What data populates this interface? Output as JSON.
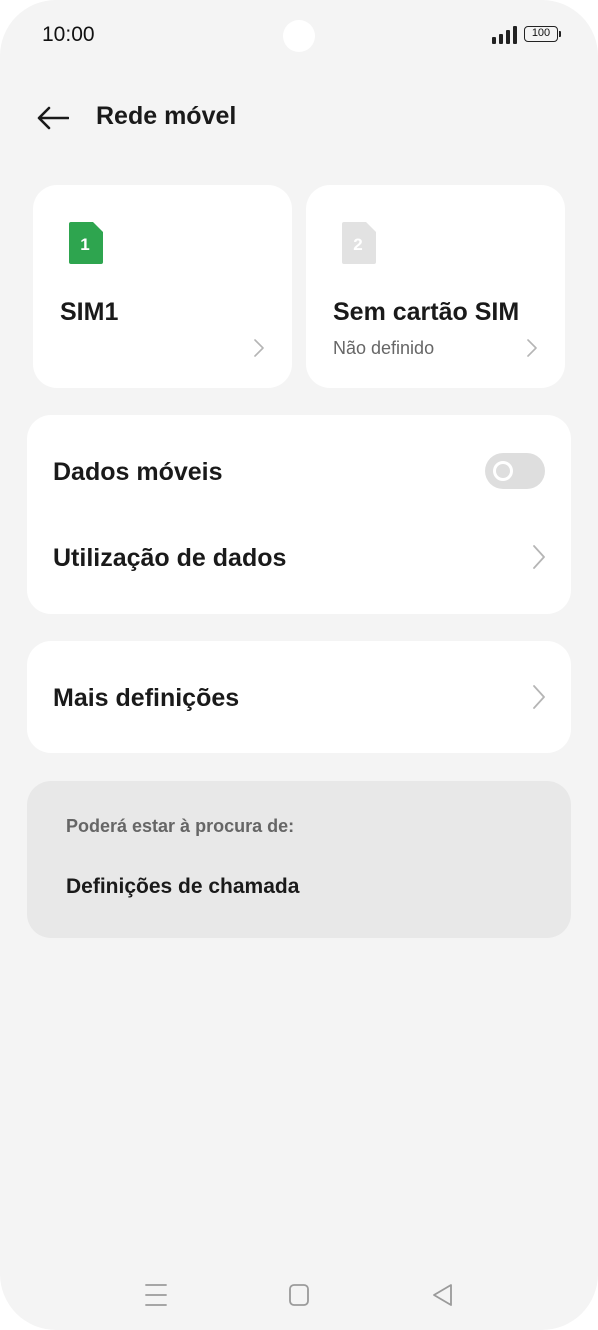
{
  "status_bar": {
    "time": "10:00",
    "battery": "100"
  },
  "header": {
    "title": "Rede móvel"
  },
  "sims": [
    {
      "badge": "1",
      "name": "SIM1",
      "status": "",
      "color": "#2ea54f"
    },
    {
      "badge": "2",
      "name": "Sem cartão SIM",
      "status": "Não definido",
      "color": "#e2e2e2"
    }
  ],
  "mobile_data": {
    "label": "Dados móveis",
    "toggle_on": false
  },
  "data_usage": {
    "label": "Utilização de dados"
  },
  "more_settings": {
    "label": "Mais definições"
  },
  "suggestions": {
    "heading": "Poderá estar à procura de:",
    "link": "Definições de chamada"
  },
  "icons": {
    "back": "back-arrow-icon",
    "chevron": "chevron-right-icon",
    "nav_menu": "menu-icon",
    "nav_home": "home-icon",
    "nav_back": "back-triangle-icon"
  }
}
